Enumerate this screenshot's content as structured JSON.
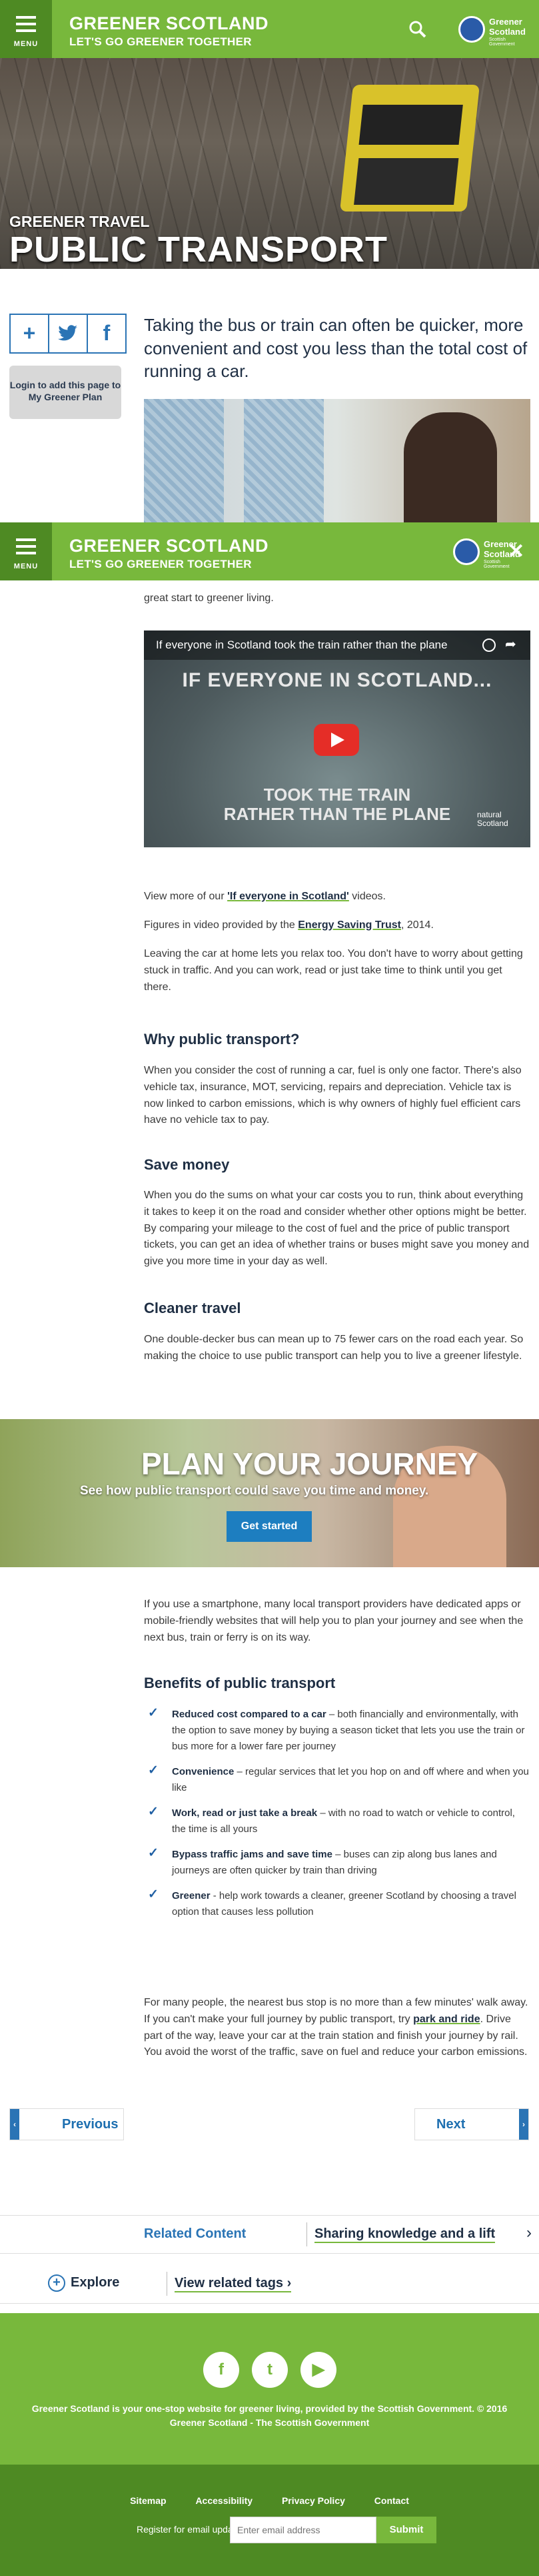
{
  "header": {
    "menu_label": "MENU",
    "brand_line1": "GREENER SCOTLAND",
    "brand_line2": "LET'S GO GREENER TOGETHER",
    "logo_title": "Greener Scotland",
    "logo_sub": "Scottish Government"
  },
  "hero": {
    "subtitle": "GREENER TRAVEL",
    "title": "PUBLIC TRANSPORT"
  },
  "share": {
    "add_icon": "plus-icon",
    "twitter_icon": "twitter-icon",
    "facebook_icon": "facebook-icon",
    "login_text": "Login to add this page to My Greener Plan"
  },
  "intro": "Taking the bus or train can often be quicker, more convenient and cost you less than the total cost of running a car.",
  "partial_text": "great start to greener living.",
  "video": {
    "title": "If everyone in Scotland took the train rather than the plane",
    "overlay_top": "IF EVERYONE IN SCOTLAND...",
    "overlay_bottom_1": "TOOK THE TRAIN",
    "overlay_bottom_2": "RATHER THAN THE PLANE",
    "logo_1": "natural",
    "logo_2": "Scotland"
  },
  "body": {
    "view_more_pre": "View more of our ",
    "view_more_link": "'If everyone in Scotland'",
    "view_more_post": " videos.",
    "figures_pre": "Figures in video provided by the ",
    "figures_link": "Energy Saving Trust",
    "figures_post": ", 2014.",
    "leave_car": "Leaving the car at home lets you relax too. You don't have to worry about getting stuck in traffic. And you can work, read or just take time to think until you get there.",
    "why_heading": "Why public transport?",
    "why_text": "When you consider the cost of running a car, fuel is only one factor. There's also vehicle tax, insurance, MOT, servicing, repairs and depreciation. Vehicle tax is now linked to carbon emissions, which is why owners of highly fuel efficient cars have no vehicle tax to pay.",
    "save_heading": "Save money",
    "save_text": "When you do the sums on what your car costs you to run, think about everything it takes to keep it on the road and consider whether other options might be better. By comparing your mileage to the cost of fuel and the price of public transport tickets, you can get an idea of whether trains or buses might save you money and give you more time in your day as well.",
    "cleaner_heading": "Cleaner travel",
    "cleaner_text": "One double-decker bus can mean up to 75 fewer cars on the road each year. So making the choice to use public transport can help you to live a greener lifestyle."
  },
  "plan": {
    "title": "PLAN YOUR JOURNEY",
    "subtitle": "See how public transport could save you time and money.",
    "button": "Get started"
  },
  "smartphone_text": "If you use a smartphone, many local transport providers have dedicated apps or mobile-friendly websites that will help you to plan your journey and see when the next bus, train or ferry is on its way.",
  "benefits": {
    "heading": "Benefits of public transport",
    "items": [
      {
        "bold": "Reduced cost compared to a car",
        "text": " – both financially and environmentally, with the option to save money by buying a season ticket that lets you use the train or bus more for a lower fare per journey"
      },
      {
        "bold": "Convenience",
        "text": " – regular services that let you hop on and off where and when you like"
      },
      {
        "bold": "Work, read or just take a break",
        "text": " – with no road to watch or vehicle to control, the time is all yours"
      },
      {
        "bold": "Bypass traffic jams and save time",
        "text": " – buses can zip along bus lanes and journeys are often quicker by train than driving"
      },
      {
        "bold": "Greener",
        "text": " - help work towards a cleaner, greener Scotland by choosing a travel option that causes less pollution"
      }
    ]
  },
  "closing": {
    "pre": "For many people, the nearest bus stop is no more than a few minutes' walk away. If you can't make your full journey by public transport, try ",
    "link": "park and ride",
    "post": ". Drive part of the way, leave your car at the train station and finish your journey by rail. You avoid the worst of the traffic, save on fuel and reduce your carbon emissions."
  },
  "pager": {
    "previous": "Previous",
    "next": "Next"
  },
  "related": {
    "label": "Related Content",
    "item": "Sharing knowledge and a lift",
    "explore": "Explore",
    "view_tags": "View related tags"
  },
  "footer": {
    "text": "Greener Scotland is your one-stop website for greener living, provided by the Scottish Government. © 2016 Greener Scotland - The Scottish Government",
    "links": [
      "Sitemap",
      "Accessibility",
      "Privacy Policy",
      "Contact"
    ],
    "email_label": "Register for email updates",
    "email_placeholder": "Enter email address",
    "submit": "Submit"
  },
  "colors": {
    "brand_green": "#78b83c",
    "dark_green": "#4e8a23",
    "link_blue": "#2a74b5",
    "heading_navy": "#1f2f44"
  }
}
